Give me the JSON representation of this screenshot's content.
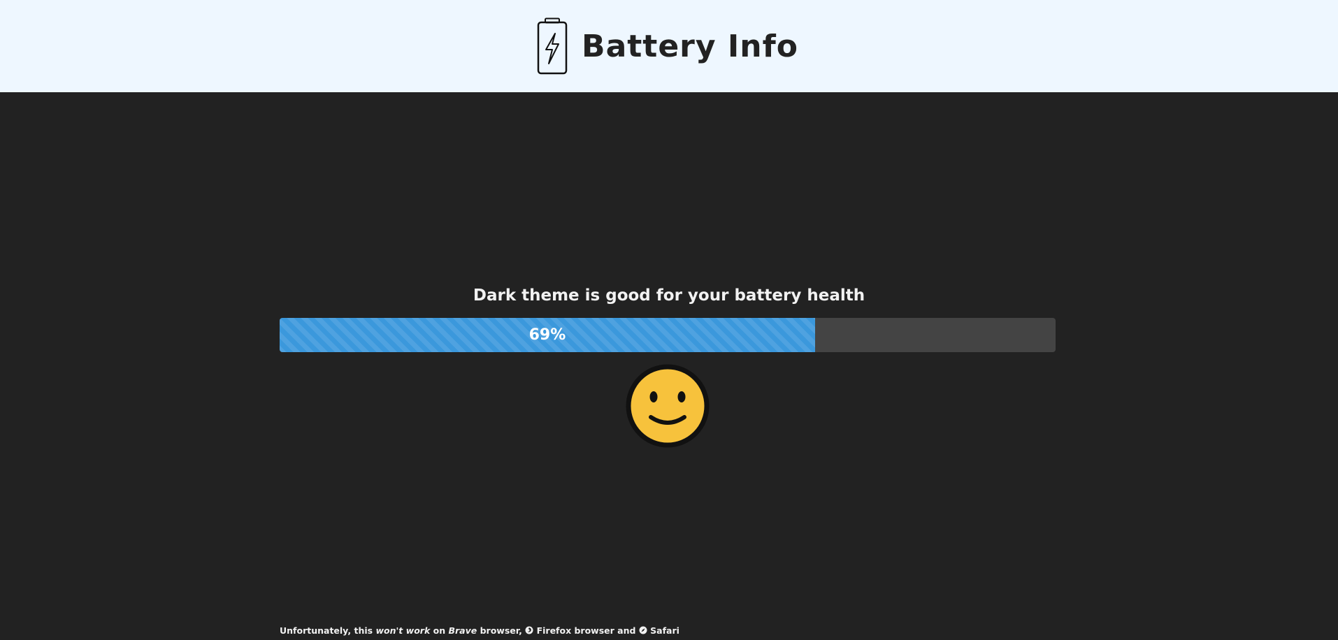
{
  "header": {
    "title": "Battery Info",
    "icon": "battery-charging-icon"
  },
  "main": {
    "tip": "Dark theme is good for your battery health",
    "battery_level_percent": 69,
    "battery_level_label": "69%",
    "status_emoji": "slightly-smiling-face-icon"
  },
  "footer": {
    "prefix": "Unfortunately, this",
    "wont": "won't",
    "work": "work",
    "on": "on",
    "brave": "Brave",
    "browser1": "browser,",
    "firefox_icon": "firefox-icon",
    "firefox": "Firefox browser and",
    "safari_icon": "safari-icon",
    "safari": "Safari"
  },
  "colors": {
    "header_bg": "#eef7ff",
    "page_bg": "#222222",
    "progress_fill": "#3b98dc",
    "progress_track": "#444444",
    "emoji_face": "#f7c23c"
  }
}
